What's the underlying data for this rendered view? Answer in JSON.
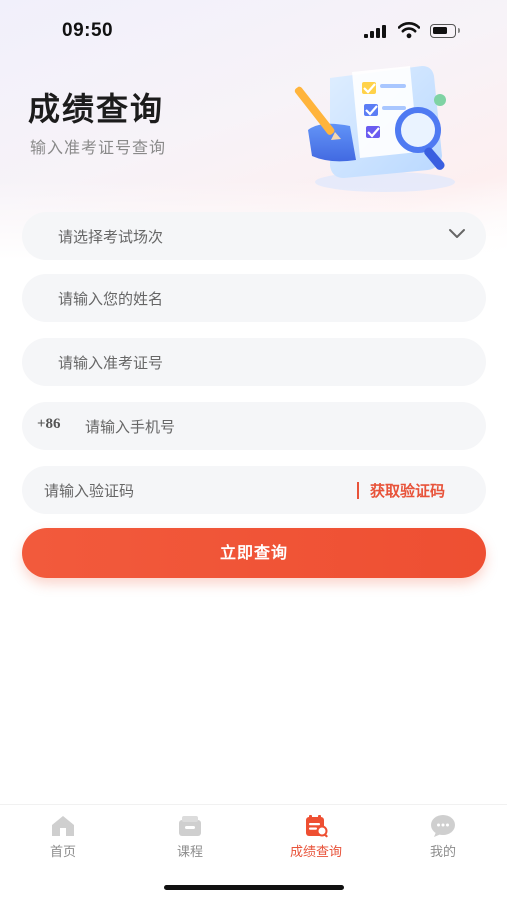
{
  "status_bar": {
    "time": "09:50"
  },
  "header": {
    "title": "成绩查询",
    "subtitle": "输入准考证号查询"
  },
  "form": {
    "exam_select_placeholder": "请选择考试场次",
    "name_placeholder": "请输入您的姓名",
    "ticket_placeholder": "请输入准考证号",
    "country_code": "+86",
    "phone_placeholder": "请输入手机号",
    "code_placeholder": "请输入验证码",
    "get_code_label": "获取验证码",
    "submit_label": "立即查询"
  },
  "tab_bar": {
    "items": [
      {
        "label": "首页",
        "icon": "home-icon",
        "active": false
      },
      {
        "label": "课程",
        "icon": "course-icon",
        "active": false
      },
      {
        "label": "成绩查询",
        "icon": "score-query-icon",
        "active": true
      },
      {
        "label": "我的",
        "icon": "chat-bubble-icon",
        "active": false
      }
    ]
  },
  "colors": {
    "accent": "#EE4F32",
    "field_background": "#F5F6F8",
    "inactive_tab": "#8D8D8D"
  }
}
